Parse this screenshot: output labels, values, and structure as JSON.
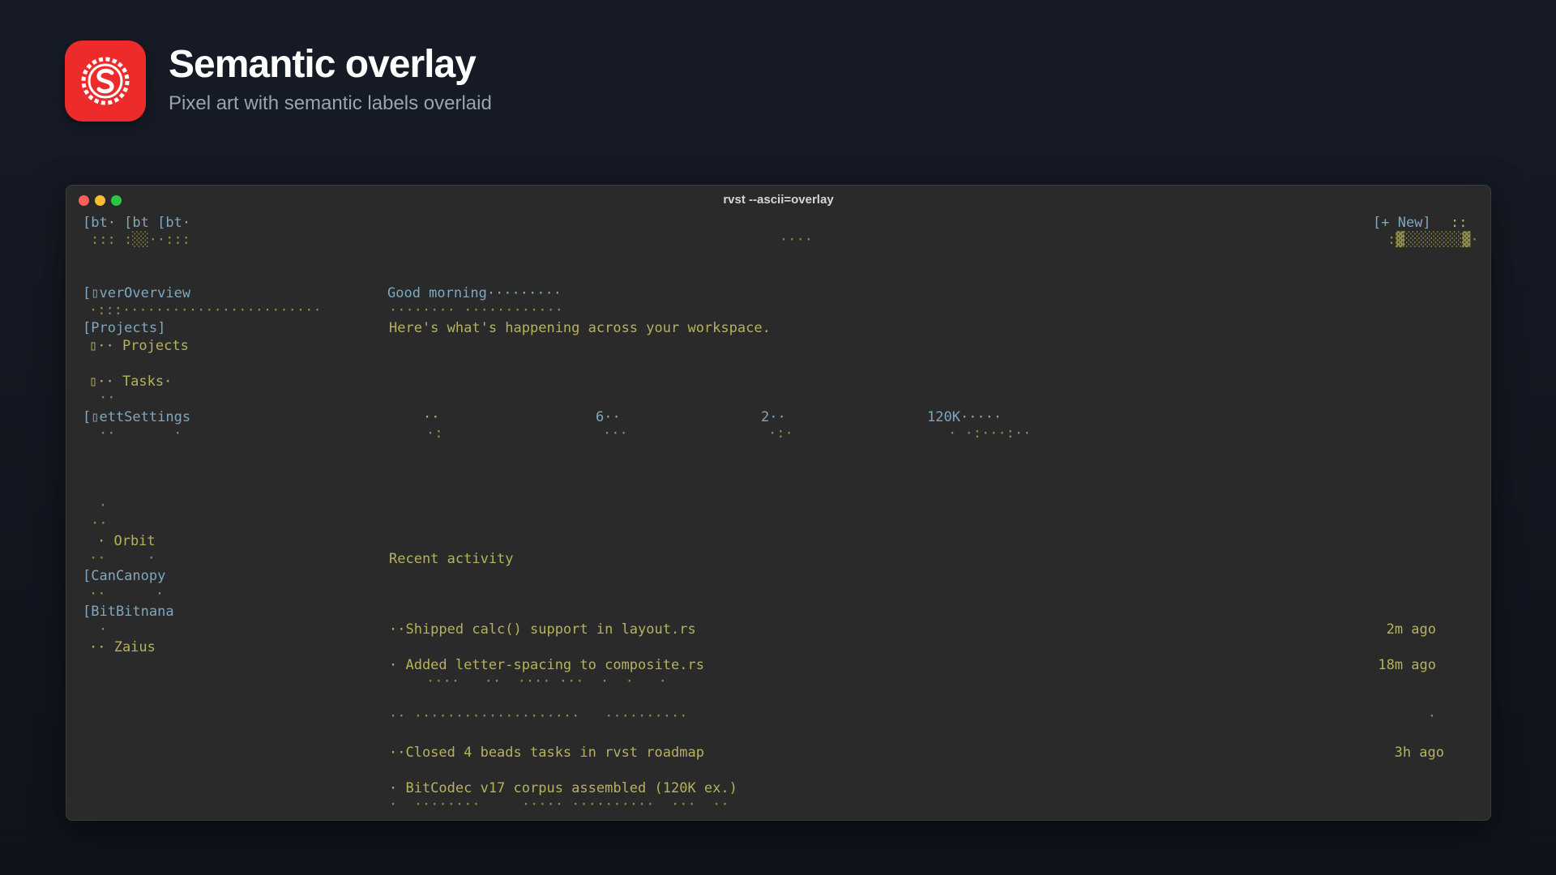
{
  "header": {
    "title": "Semantic overlay",
    "subtitle": "Pixel art with semantic labels overlaid",
    "icon": "svelte-logo-icon",
    "accent": "#ee2b2b"
  },
  "window": {
    "title": "rvst --ascii=overlay",
    "controls": [
      "close",
      "minimize",
      "maximize"
    ]
  },
  "topbar": {
    "tabs_label": "[bt· [bt [bt·",
    "tabs_dots": "::: :░░··:::",
    "center_dots": "····",
    "new_button": "[+ New]",
    "new_button_dots": "::",
    "new_button_bar": ":▓░░░░░░░▓·"
  },
  "sidebar": {
    "overview": "[▯verOverview",
    "overview_dots": "·:::························",
    "projects_group": "[Projects]",
    "projects_item": "▯·· Projects",
    "tasks_item": "▯·· Tasks·",
    "tasks_dots": "··",
    "settings": "[▯ettSettings",
    "settings_dots": "··       ·",
    "gap_dot_1": "·",
    "gap_dot_2": "··",
    "orbit": "· Orbit",
    "orbit_dots": "··     ·",
    "canopy": "[CanCanopy",
    "canopy_dots": "··      ·",
    "bitnana": "[BitBitnana",
    "bitnana_dots": "·",
    "zaius": "·· Zaius"
  },
  "main": {
    "greeting": "Good morning·········",
    "greeting_dots": "········ ············",
    "intro": "Here's what's happening across your workspace.",
    "stats": [
      {
        "value": "··",
        "dots": "·:"
      },
      {
        "value": "6··",
        "dots": "···"
      },
      {
        "value": "2··",
        "dots": "·:·"
      },
      {
        "value": "120K·····",
        "dots": "· ·:···:··"
      }
    ],
    "recent_title": "Recent activity",
    "activity": [
      {
        "text": "··Shipped calc() support in layout.rs",
        "time": "2m ago",
        "dots": ""
      },
      {
        "text": "· Added letter-spacing to composite.rs",
        "time": "18m ago",
        "dots": "····   ··  ···· ···  ·  ·   ·"
      },
      {
        "text": "·· ····················   ··········",
        "time": "·",
        "dots": ""
      },
      {
        "text": "··Closed 4 beads tasks in rvst roadmap",
        "time": "3h ago",
        "dots": ""
      },
      {
        "text": "· BitCodec v17 corpus assembled (120K ex.)",
        "time": "",
        "dots": "·  ········     ····· ··········  ···  ··"
      }
    ]
  }
}
